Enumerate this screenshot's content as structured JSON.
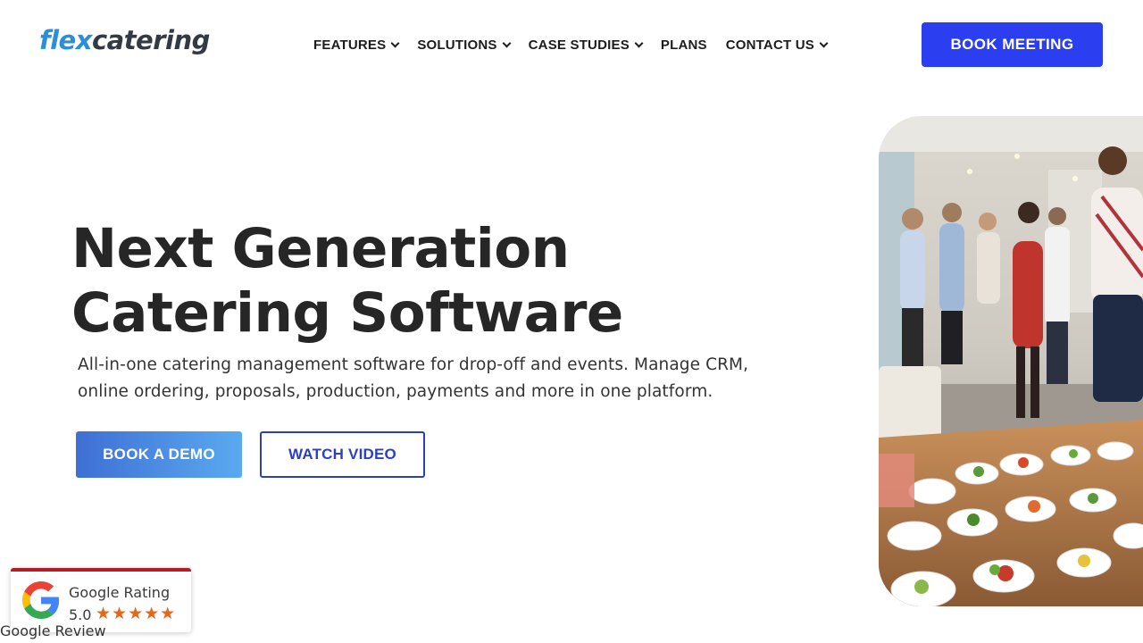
{
  "brand": {
    "part1": "flex",
    "part2": "catering"
  },
  "nav": {
    "items": [
      {
        "label": "FEATURES",
        "dropdown": true
      },
      {
        "label": "SOLUTIONS",
        "dropdown": true
      },
      {
        "label": "CASE STUDIES",
        "dropdown": true
      },
      {
        "label": "PLANS",
        "dropdown": false
      },
      {
        "label": "CONTACT US",
        "dropdown": true
      }
    ],
    "cta": "BOOK MEETING"
  },
  "hero": {
    "title_line1": "Next Generation",
    "title_line2": "Catering Software",
    "subtitle_line1": "All-in-one catering management software for drop-off and events. Manage CRM,",
    "subtitle_line2": "online ordering, proposals, production, payments and more in one platform.",
    "primary_button": "BOOK A DEMO",
    "secondary_button": "WATCH VIDEO"
  },
  "google_badge": {
    "title": "Google Rating",
    "score": "5.0",
    "stars": "★★★★★",
    "footer": "Google Review"
  },
  "colors": {
    "primary": "#2b3ff0",
    "brand_blue": "#2a8fd6",
    "badge_red": "#b71c26",
    "star": "#e06a1a"
  }
}
